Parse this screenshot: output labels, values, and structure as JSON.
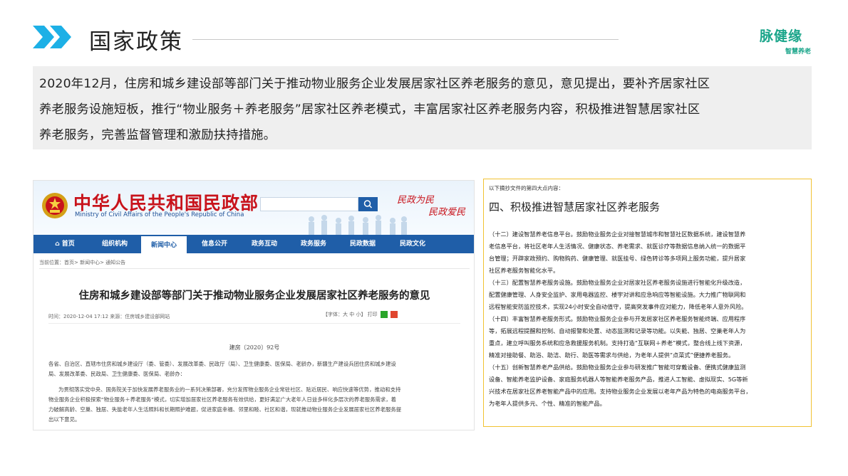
{
  "header": {
    "title": "国家政策",
    "logo_main": "脉健缘",
    "logo_sub": "智慧养老"
  },
  "intro": {
    "lines": [
      "2020年12月，住房和城乡建设部等部门关于推动物业服务企业发展居家社区养老服务的意见，意见提出，要补齐居家社区",
      "养老服务设施短板，推行“物业服务＋养老服务”居家社区养老模式，丰富居家社区养老服务内容，积极推进智慧居家社区",
      "养老服务，完善监督管理和激励扶持措施。"
    ]
  },
  "site": {
    "ministry_cn": "中华人民共和国民政部",
    "ministry_en": "Ministry of Civil Affairs of the People's Republic of China",
    "slogan1": "民政为民",
    "slogan2": "民政爱民",
    "nav": [
      "首页",
      "组织机构",
      "新闻中心",
      "信息公开",
      "政务服务",
      "政务服务",
      "民政数据",
      "民政文化"
    ],
    "nav_active": "新闻中心",
    "breadcrumb": "当前位置：首页> 新闻中心> 通知公告",
    "article_title": "住房和城乡建设部等部门关于推动物业服务企业发展居家社区养老服务的意见",
    "meta": "时间：2020-12-04 17:12  来源：住房城乡建设部网站",
    "tools": "【字体：大 中 小】  打印",
    "doc_number": "建房〔2020〕92号",
    "recipients": [
      "各省、自治区、直辖市住房和城乡建设厅（委、管委）、发展改革委、民政厅（局）、卫生健康委、医保局、老龄办，新疆生产建设兵团住房和城乡建设",
      "局、发展改革委、民政局、卫生健康委、医保局、老龄办："
    ],
    "paragraph": [
      "为贯彻落实党中央、国务院关于加快发展养老服务业的一系列决策部署，充分发挥物业服务企业常驻社区、贴近居民、响应快速等优势，推动和支持",
      "物业服务企业积极探索“物业服务＋养老服务”模式，切实增加居家社区养老服务有效供给，更好满足广大老年人日益多样化多层次的养老服务需求，着",
      "力破解高龄、空巢、独居、失能老年人生活照料和长期照护难题，促进家庭幸福、邻里和睦、社区和谐，现就推动物业服务企业发展居家社区养老服务提",
      "出以下意见。"
    ]
  },
  "excerpt": {
    "note": "以下摘抄文件的第四大点内容：",
    "heading": "四、积极推进智慧居家社区养老服务",
    "lines": [
      "（十二）建设智慧养老信息平台。鼓励物业服务企业对接智慧城市和智慧社区数据系统，建设智慧养",
      "老信息平台，将社区老年人生活情况、健康状态、养老需求、就医诊疗等数据信息纳入统一的数据平",
      "台管理；开辟家政预约、购物购药、健康管理、就医挂号、绿色转诊等多项网上服务功能，提升居家",
      "社区养老服务智能化水平。",
      "（十三）配置智慧养老服务设施。鼓励物业服务企业对居家社区养老服务设施进行智能化升级改造，",
      "配置健康管理、人身安全监护、家用电器监控、楼宇对讲和应急响应等智能设施。大力推广物联网和",
      "远程智能安防监控技术，实现24小时安全自动值守，提高突发事件应对能力，降低老年人意外风险。",
      "（十四）丰富智慧养老服务形式。鼓励物业服务企业参与开发居家社区养老服务智能终端、应用程序",
      "等，拓展远程提醒和控制、自动报警和处置、动态监测和记录等功能。以失能、独居、空巢老年人为",
      "重点，建立呼叫服务系统和应急救援服务机制。支持打造“互联网＋养老”模式，整合线上线下资源，",
      "精准对接助餐、助浴、助洁、助行、助医等需求与供给，为老年人提供“点菜式”便捷养老服务。",
      "（十五）创新智慧养老产品供给。鼓励物业服务企业参与研发推广智能可穿戴设备、便携式健康监测",
      "设备、智能养老监护设备、家庭服务机器人等智能养老服务产品，推进人工智能、虚拟现实、5G等新",
      "兴技术在居家社区养老智能产品中的应用。支持物业服务企业发展以老年产品为特色的电商服务平台，",
      "为老年人提供多元、个性、精准的智能产品。"
    ]
  },
  "colors": {
    "accent_cyan": "#1db0e6",
    "logo_green": "#1aa58a",
    "site_blue": "#1f5ea8",
    "site_red": "#c8131b",
    "excerpt_border": "#f1c232"
  }
}
